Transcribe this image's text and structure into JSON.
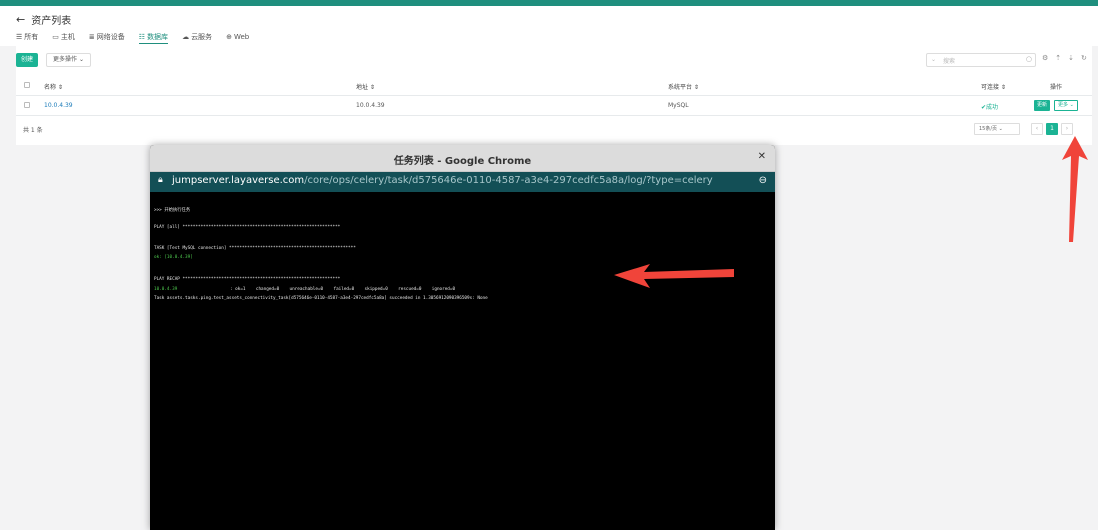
{
  "header": {
    "back_icon": "left-arrow-icon",
    "title": "资产列表",
    "tabs": [
      {
        "label": "所有",
        "icon": "list-icon"
      },
      {
        "label": "主机",
        "icon": "monitor-icon"
      },
      {
        "label": "网络设备",
        "icon": "network-icon"
      },
      {
        "label": "数据库",
        "icon": "database-icon"
      },
      {
        "label": "云服务",
        "icon": "cloud-icon"
      },
      {
        "label": "Web",
        "icon": "globe-icon"
      }
    ],
    "active_tab": "数据库"
  },
  "toolbar": {
    "create_label": "创建",
    "more_actions_label": "更多操作",
    "search_placeholder": "搜索"
  },
  "table": {
    "columns": [
      "名称",
      "地址",
      "系统平台",
      "可连接",
      "操作"
    ],
    "rows": [
      {
        "name": "10.0.4.39",
        "address": "10.0.4.39",
        "platform": "MySQL",
        "connectivity": "成功",
        "update_label": "更新",
        "more_label": "更多"
      }
    ],
    "total_text": "共 1 条",
    "page_size": "15条/页",
    "current_page": "1"
  },
  "popup": {
    "title": "任务列表 - Google Chrome",
    "url_host": "jumpserver.layaverse.com",
    "url_path": "/core/ops/celery/task/d575646e-0110-4587-a3e4-297cedfc5a8a/log/?type=celery",
    "log_lines": [
      ">>> 开始执行任务",
      "PLAY [all] *************************************************************",
      "TASK [Test MySQL connection] *************************************************",
      "ok: [10.0.4.39]",
      "PLAY RECAP *************************************************************",
      "10.0.4.39",
      ": ok=1    changed=0    unreachable=0    failed=0    skipped=0    rescued=0    ignored=0",
      "Task assets.tasks.ping.test_assets_connectivity_task[d575646e-0110-4587-a3e4-297cedfc5a8a] succeeded in 1.3056912090396509s: None"
    ]
  },
  "colors": {
    "accent": "#1bb394",
    "header_bar": "#1f8f7e",
    "url_bar": "#134f56",
    "annotation_arrow": "#f0443a"
  }
}
